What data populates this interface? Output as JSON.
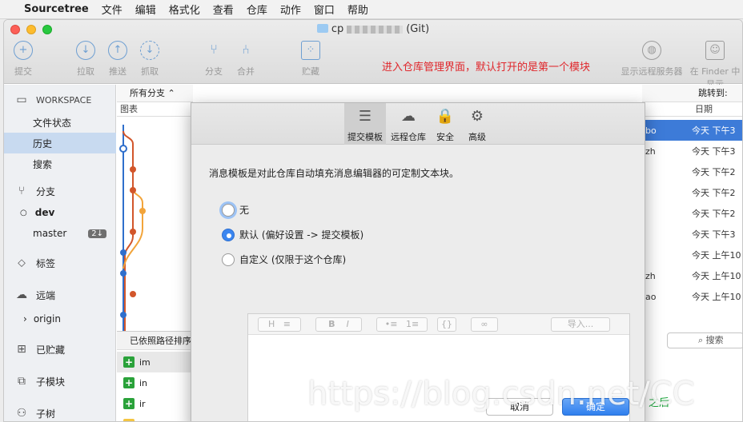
{
  "menubar": {
    "app": "Sourcetree",
    "items": [
      "文件",
      "编辑",
      "格式化",
      "查看",
      "仓库",
      "动作",
      "窗口",
      "帮助"
    ]
  },
  "window": {
    "title_prefix": "cp",
    "title_suffix": "(Git)"
  },
  "toolbar": {
    "commit": "提交",
    "pull": "拉取",
    "push": "推送",
    "fetch": "抓取",
    "branch": "分支",
    "merge": "合并",
    "stash": "贮藏",
    "show_remote": "显示远程服务器",
    "show_finder": "在 Finder 中显示"
  },
  "annotation": "进入仓库管理界面，默认打开的是第一个模块",
  "sidebar": {
    "workspace": "WORKSPACE",
    "file_status": "文件状态",
    "history": "历史",
    "search": "搜索",
    "branches": "分支",
    "branch_dev": "dev",
    "branch_master": "master",
    "master_badge": "2↓",
    "tags": "标签",
    "remotes": "远端",
    "remote_origin": "origin",
    "stashes": "已贮藏",
    "submodules": "子模块",
    "subtrees": "子树"
  },
  "graph_pane": {
    "filter": "所有分支",
    "column": "图表",
    "sort_label": "已依照路径排序",
    "files": [
      {
        "type": "add",
        "name": "im"
      },
      {
        "type": "add",
        "name": "in"
      },
      {
        "type": "add",
        "name": "ir"
      },
      {
        "type": "mod",
        "name": "lib"
      }
    ]
  },
  "right_pane": {
    "jump_to": "跳转到:",
    "date_col": "日期",
    "rows": [
      {
        "author": "bo",
        "date": "今天 下午3"
      },
      {
        "author": "zh",
        "date": "今天 下午3"
      },
      {
        "author": "",
        "date": "今天 下午2"
      },
      {
        "author": "",
        "date": "今天 下午2"
      },
      {
        "author": "",
        "date": "今天 下午2"
      },
      {
        "author": "",
        "date": "今天 下午3"
      },
      {
        "author": "",
        "date": "今天 上午10"
      },
      {
        "author": "zh",
        "date": "今天 上午10"
      },
      {
        "author": "ao",
        "date": "今天 上午10"
      }
    ],
    "search": "搜索",
    "footer_green": "之后"
  },
  "sheet": {
    "tabs": [
      {
        "label": "提交模板",
        "icon": "doc-icon"
      },
      {
        "label": "远程仓库",
        "icon": "cloud-icon"
      },
      {
        "label": "安全",
        "icon": "lock-icon"
      },
      {
        "label": "高级",
        "icon": "gear-icon"
      }
    ],
    "description": "消息模板是对此仓库自动填充消息编辑器的可定制文本块。",
    "options": [
      {
        "label": "无",
        "selected": false
      },
      {
        "label": "默认 (偏好设置 -> 提交模板)",
        "selected": true
      },
      {
        "label": "自定义 (仅限于这个仓库)",
        "selected": false
      }
    ],
    "editor_buttons": [
      "H",
      "≡",
      "B",
      "I",
      "•≡",
      "1≡",
      "{}",
      "∞"
    ],
    "import_button": "导入...",
    "cancel": "取消",
    "ok": "确定"
  },
  "watermark": "https://blog.csdn.net/CC"
}
